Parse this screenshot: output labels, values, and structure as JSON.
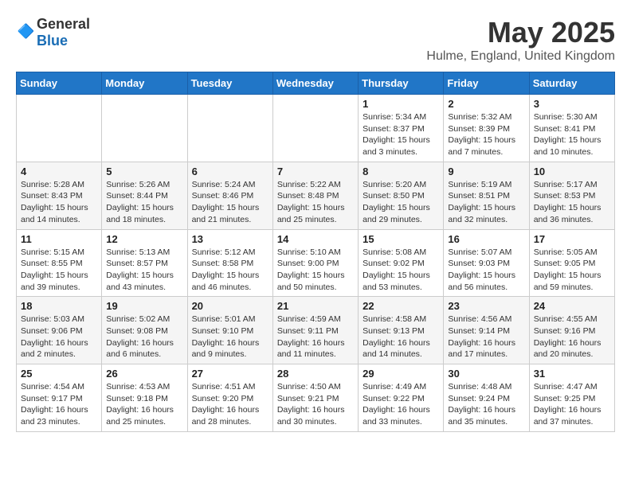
{
  "header": {
    "logo_general": "General",
    "logo_blue": "Blue",
    "title": "May 2025",
    "subtitle": "Hulme, England, United Kingdom"
  },
  "days_of_week": [
    "Sunday",
    "Monday",
    "Tuesday",
    "Wednesday",
    "Thursday",
    "Friday",
    "Saturday"
  ],
  "weeks": [
    [
      {
        "day": "",
        "info": ""
      },
      {
        "day": "",
        "info": ""
      },
      {
        "day": "",
        "info": ""
      },
      {
        "day": "",
        "info": ""
      },
      {
        "day": "1",
        "info": "Sunrise: 5:34 AM\nSunset: 8:37 PM\nDaylight: 15 hours\nand 3 minutes."
      },
      {
        "day": "2",
        "info": "Sunrise: 5:32 AM\nSunset: 8:39 PM\nDaylight: 15 hours\nand 7 minutes."
      },
      {
        "day": "3",
        "info": "Sunrise: 5:30 AM\nSunset: 8:41 PM\nDaylight: 15 hours\nand 10 minutes."
      }
    ],
    [
      {
        "day": "4",
        "info": "Sunrise: 5:28 AM\nSunset: 8:43 PM\nDaylight: 15 hours\nand 14 minutes."
      },
      {
        "day": "5",
        "info": "Sunrise: 5:26 AM\nSunset: 8:44 PM\nDaylight: 15 hours\nand 18 minutes."
      },
      {
        "day": "6",
        "info": "Sunrise: 5:24 AM\nSunset: 8:46 PM\nDaylight: 15 hours\nand 21 minutes."
      },
      {
        "day": "7",
        "info": "Sunrise: 5:22 AM\nSunset: 8:48 PM\nDaylight: 15 hours\nand 25 minutes."
      },
      {
        "day": "8",
        "info": "Sunrise: 5:20 AM\nSunset: 8:50 PM\nDaylight: 15 hours\nand 29 minutes."
      },
      {
        "day": "9",
        "info": "Sunrise: 5:19 AM\nSunset: 8:51 PM\nDaylight: 15 hours\nand 32 minutes."
      },
      {
        "day": "10",
        "info": "Sunrise: 5:17 AM\nSunset: 8:53 PM\nDaylight: 15 hours\nand 36 minutes."
      }
    ],
    [
      {
        "day": "11",
        "info": "Sunrise: 5:15 AM\nSunset: 8:55 PM\nDaylight: 15 hours\nand 39 minutes."
      },
      {
        "day": "12",
        "info": "Sunrise: 5:13 AM\nSunset: 8:57 PM\nDaylight: 15 hours\nand 43 minutes."
      },
      {
        "day": "13",
        "info": "Sunrise: 5:12 AM\nSunset: 8:58 PM\nDaylight: 15 hours\nand 46 minutes."
      },
      {
        "day": "14",
        "info": "Sunrise: 5:10 AM\nSunset: 9:00 PM\nDaylight: 15 hours\nand 50 minutes."
      },
      {
        "day": "15",
        "info": "Sunrise: 5:08 AM\nSunset: 9:02 PM\nDaylight: 15 hours\nand 53 minutes."
      },
      {
        "day": "16",
        "info": "Sunrise: 5:07 AM\nSunset: 9:03 PM\nDaylight: 15 hours\nand 56 minutes."
      },
      {
        "day": "17",
        "info": "Sunrise: 5:05 AM\nSunset: 9:05 PM\nDaylight: 15 hours\nand 59 minutes."
      }
    ],
    [
      {
        "day": "18",
        "info": "Sunrise: 5:03 AM\nSunset: 9:06 PM\nDaylight: 16 hours\nand 2 minutes."
      },
      {
        "day": "19",
        "info": "Sunrise: 5:02 AM\nSunset: 9:08 PM\nDaylight: 16 hours\nand 6 minutes."
      },
      {
        "day": "20",
        "info": "Sunrise: 5:01 AM\nSunset: 9:10 PM\nDaylight: 16 hours\nand 9 minutes."
      },
      {
        "day": "21",
        "info": "Sunrise: 4:59 AM\nSunset: 9:11 PM\nDaylight: 16 hours\nand 11 minutes."
      },
      {
        "day": "22",
        "info": "Sunrise: 4:58 AM\nSunset: 9:13 PM\nDaylight: 16 hours\nand 14 minutes."
      },
      {
        "day": "23",
        "info": "Sunrise: 4:56 AM\nSunset: 9:14 PM\nDaylight: 16 hours\nand 17 minutes."
      },
      {
        "day": "24",
        "info": "Sunrise: 4:55 AM\nSunset: 9:16 PM\nDaylight: 16 hours\nand 20 minutes."
      }
    ],
    [
      {
        "day": "25",
        "info": "Sunrise: 4:54 AM\nSunset: 9:17 PM\nDaylight: 16 hours\nand 23 minutes."
      },
      {
        "day": "26",
        "info": "Sunrise: 4:53 AM\nSunset: 9:18 PM\nDaylight: 16 hours\nand 25 minutes."
      },
      {
        "day": "27",
        "info": "Sunrise: 4:51 AM\nSunset: 9:20 PM\nDaylight: 16 hours\nand 28 minutes."
      },
      {
        "day": "28",
        "info": "Sunrise: 4:50 AM\nSunset: 9:21 PM\nDaylight: 16 hours\nand 30 minutes."
      },
      {
        "day": "29",
        "info": "Sunrise: 4:49 AM\nSunset: 9:22 PM\nDaylight: 16 hours\nand 33 minutes."
      },
      {
        "day": "30",
        "info": "Sunrise: 4:48 AM\nSunset: 9:24 PM\nDaylight: 16 hours\nand 35 minutes."
      },
      {
        "day": "31",
        "info": "Sunrise: 4:47 AM\nSunset: 9:25 PM\nDaylight: 16 hours\nand 37 minutes."
      }
    ]
  ]
}
